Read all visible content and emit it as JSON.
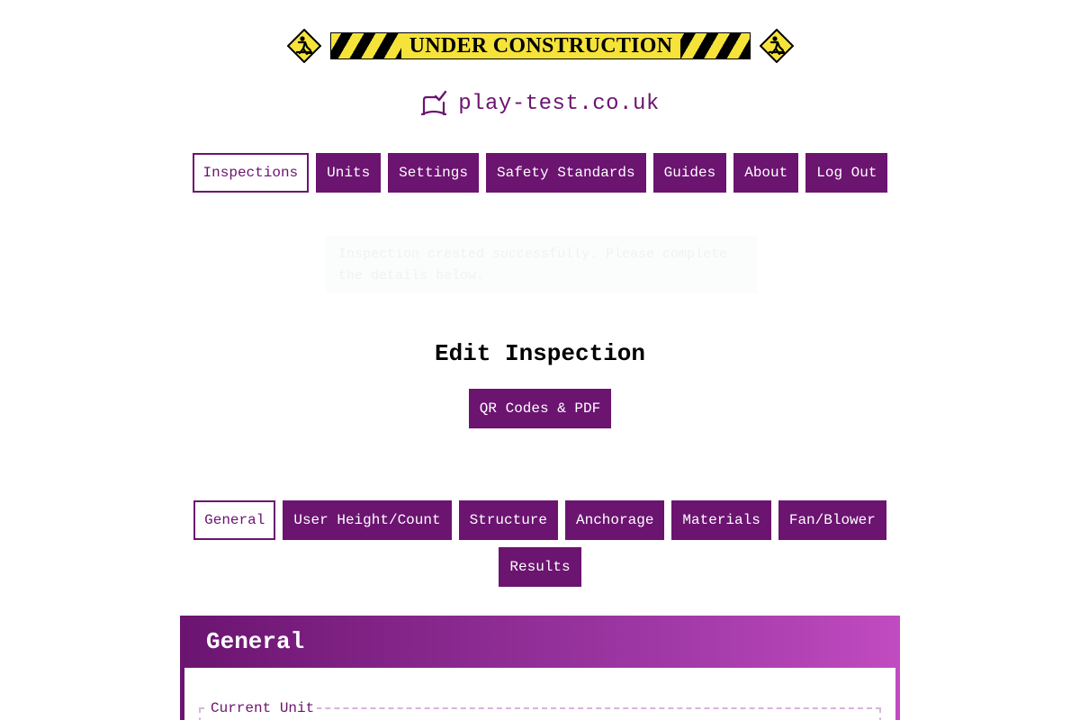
{
  "banner": {
    "text": "UNDER CONSTRUCTION"
  },
  "site": {
    "name": "play-test.co.uk"
  },
  "nav": {
    "items": [
      {
        "label": "Inspections",
        "active": true
      },
      {
        "label": "Units",
        "active": false
      },
      {
        "label": "Settings",
        "active": false
      },
      {
        "label": "Safety Standards",
        "active": false
      },
      {
        "label": "Guides",
        "active": false
      },
      {
        "label": "About",
        "active": false
      },
      {
        "label": "Log Out",
        "active": false
      }
    ]
  },
  "notice": {
    "text": "Inspection created successfully. Please complete the details below."
  },
  "page": {
    "title": "Edit Inspection",
    "qr_button": "QR Codes & PDF"
  },
  "tabs": [
    {
      "label": "General",
      "active": true
    },
    {
      "label": "User Height/Count",
      "active": false
    },
    {
      "label": "Structure",
      "active": false
    },
    {
      "label": "Anchorage",
      "active": false
    },
    {
      "label": "Materials",
      "active": false
    },
    {
      "label": "Fan/Blower",
      "active": false
    },
    {
      "label": "Results",
      "active": false
    }
  ],
  "section": {
    "title": "General",
    "fieldset_legend": "Current Unit"
  },
  "colors": {
    "brand": "#6b1470",
    "warning_yellow": "#f6e33a",
    "gradient_end": "#c14bc0"
  }
}
